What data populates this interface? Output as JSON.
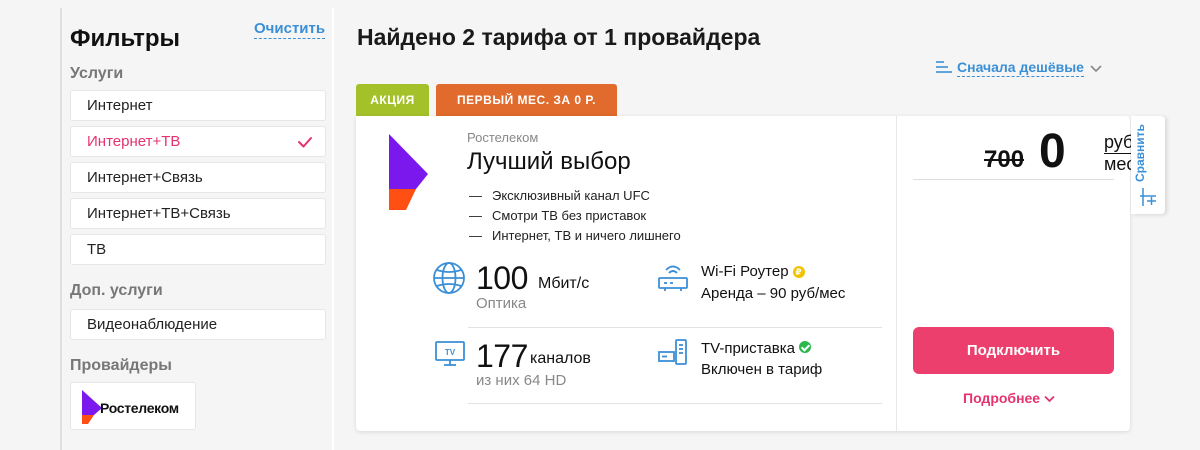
{
  "sidebar": {
    "title": "Фильтры",
    "clear_label": "Очистить",
    "services_label": "Услуги",
    "services": [
      {
        "label": "Интернет",
        "active": false
      },
      {
        "label": "Интернет+ТВ",
        "active": true
      },
      {
        "label": "Интернет+Связь",
        "active": false
      },
      {
        "label": "Интернет+ТВ+Связь",
        "active": false
      },
      {
        "label": "ТВ",
        "active": false
      }
    ],
    "extra_label": "Доп. услуги",
    "extra_services": [
      {
        "label": "Видеонаблюдение",
        "active": false
      }
    ],
    "providers_label": "Провайдеры",
    "providers": [
      {
        "name": "Ростелеком"
      }
    ]
  },
  "main": {
    "results_title": "Найдено 2 тарифа от 1 провайдера",
    "sort_label": "Сначала дешёвые"
  },
  "tariff": {
    "badges": {
      "promo": "АКЦИЯ",
      "first_month": "ПЕРВЫЙ МЕС. ЗА 0 Р."
    },
    "provider": "Ростелеком",
    "name": "Лучший выбор",
    "features": [
      "Эксклюзивный канал UFC",
      "Смотри ТВ без приставок",
      "Интернет, ТВ и ничего лишнего"
    ],
    "speed": {
      "value": "100",
      "unit": "Мбит/с",
      "type": "Оптика"
    },
    "router": {
      "title": "Wi-Fi Роутер",
      "detail": "Аренда – 90 руб/мес",
      "badge": "₽"
    },
    "channels": {
      "value": "177",
      "unit": "каналов",
      "detail": "из них 64 HD"
    },
    "tvbox": {
      "title": "TV-приставка",
      "detail": "Включен в тариф"
    },
    "price": {
      "old": "700",
      "current": "0",
      "unit_top": "руб",
      "unit_bottom": "мес"
    },
    "connect_label": "Подключить",
    "more_label": "Подробнее",
    "compare_label": "Сравнить"
  },
  "colors": {
    "brand_purple": "#7b18ee",
    "brand_orange": "#ff4f12",
    "accent_pink": "#ed3f6d",
    "link_blue": "#3b8fd6",
    "promo_green": "#a4c12a",
    "promo_orange": "#e06b2c"
  },
  "icons": [
    "check-icon",
    "sort-lines-icon",
    "chevron-down-icon",
    "globe-icon",
    "router-icon",
    "tv-icon",
    "tv-box-icon",
    "coin-icon",
    "ok-check-icon",
    "compare-icon",
    "rostelecom-logo"
  ]
}
